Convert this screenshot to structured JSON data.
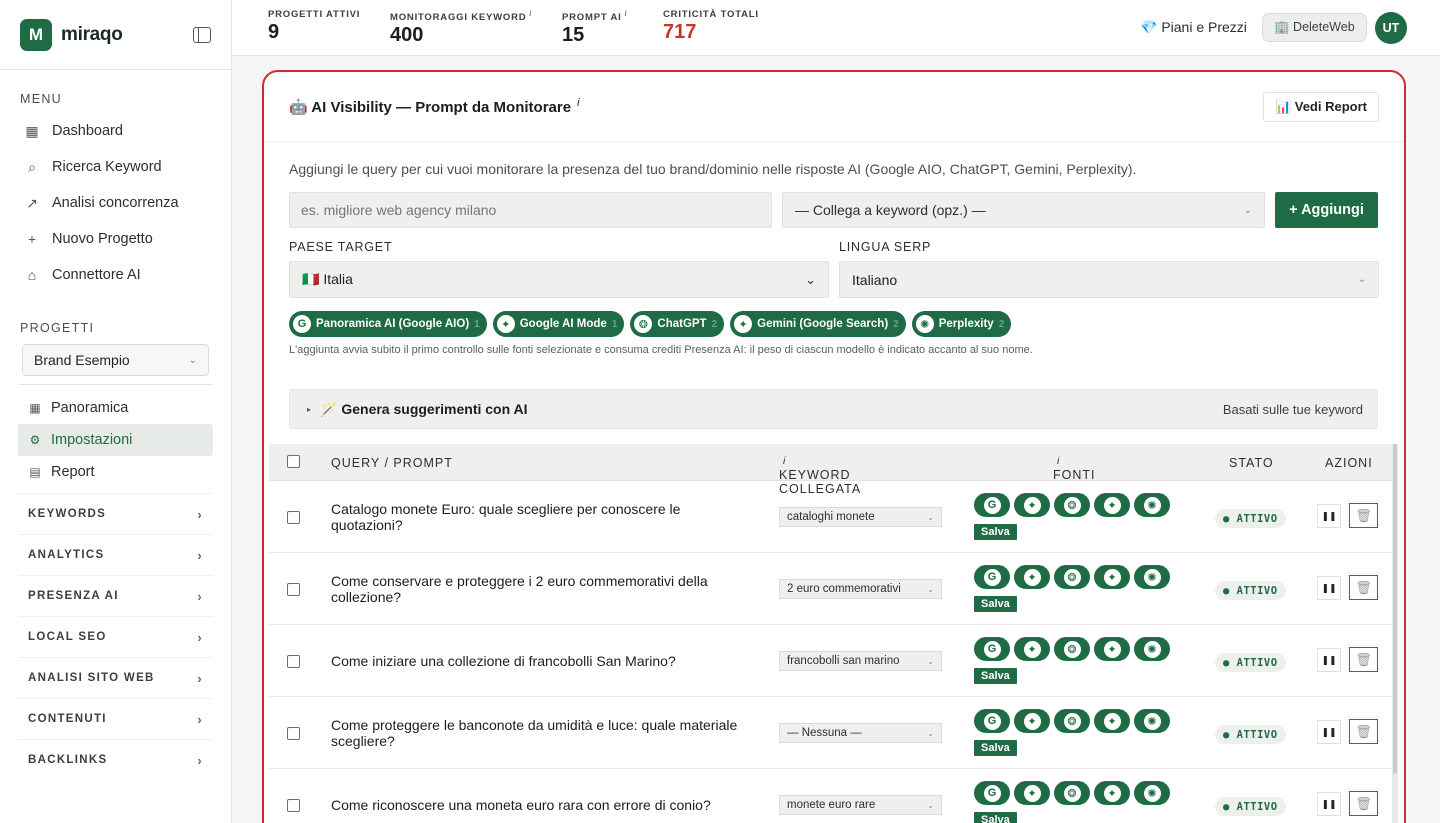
{
  "app": {
    "logo_letter": "M",
    "name": "miraqo"
  },
  "sidebar": {
    "menu_label": "MENU",
    "menu": [
      {
        "label": "Dashboard",
        "icon": "grid-icon"
      },
      {
        "label": "Ricerca Keyword",
        "icon": "search-icon"
      },
      {
        "label": "Analisi concorrenza",
        "icon": "chart-line-icon"
      },
      {
        "label": "Nuovo Progetto",
        "icon": "plus-icon"
      },
      {
        "label": "Connettore AI",
        "icon": "robot-icon"
      }
    ],
    "projects_label": "PROGETTI",
    "project_select": "Brand Esempio",
    "project_nav": [
      {
        "label": "Panoramica",
        "icon": "grid-small-icon"
      },
      {
        "label": "Impostazioni",
        "icon": "gear-icon"
      },
      {
        "label": "Report",
        "icon": "document-icon"
      }
    ],
    "groups": [
      "KEYWORDS",
      "ANALYTICS",
      "PRESENZA AI",
      "LOCAL SEO",
      "ANALISI SITO WEB",
      "CONTENUTI",
      "BACKLINKS"
    ]
  },
  "topbar": {
    "stats": [
      {
        "label": "PROGETTI ATTIVI",
        "value": "9",
        "info": ""
      },
      {
        "label": "MONITORAGGI KEYWORD",
        "value": "400",
        "info": "i"
      },
      {
        "label": "PROMPT AI",
        "value": "15",
        "info": "i"
      },
      {
        "label": "CRITICITÀ TOTALI",
        "value": "717",
        "info": ""
      }
    ],
    "plans_link": "💎 Piani e Prezzi",
    "workspace_button": "🏢 DeleteWeb",
    "avatar": "UT"
  },
  "card": {
    "title": "🤖 AI Visibility — Prompt da Monitorare",
    "title_info": "i",
    "report_button": "📊 Vedi Report",
    "intro": "Aggiungi le query per cui vuoi monitorare la presenza del tuo brand/dominio nelle risposte AI (Google AIO, ChatGPT, Gemini, Perplexity).",
    "query_placeholder": "es. migliore web agency milano",
    "keyword_select": "— Collega a keyword (opz.) —",
    "add_button": "+ Aggiungi",
    "country_label": "PAESE TARGET",
    "country_value": "🇮🇹 Italia",
    "language_label": "LINGUA SERP",
    "language_value": "Italiano",
    "sources": [
      {
        "label": "Panoramica AI (Google AIO)",
        "icon": "google-icon",
        "glyph": "G",
        "weight": "1"
      },
      {
        "label": "Google AI Mode",
        "icon": "sparkle-icon",
        "glyph": "✦",
        "weight": "1"
      },
      {
        "label": "ChatGPT",
        "icon": "openai-icon",
        "glyph": "❂",
        "weight": "2"
      },
      {
        "label": "Gemini (Google Search)",
        "icon": "gemini-icon",
        "glyph": "✦",
        "weight": "2"
      },
      {
        "label": "Perplexity",
        "icon": "perplexity-icon",
        "glyph": "✺",
        "weight": "2"
      }
    ],
    "note": "L'aggiunta avvia subito il primo controllo sulle fonti selezionate e consuma crediti Presenza AI: il peso di ciascun modello è indicato accanto al suo nome.",
    "suggest_title": "🪄 Genera suggerimenti con AI",
    "suggest_right": "Basati sulle tue keyword"
  },
  "table": {
    "headers": {
      "query": "QUERY / PROMPT",
      "keyword": "KEYWORD COLLEGATA",
      "sources": "FONTI",
      "status": "STATO",
      "actions": "AZIONI",
      "info": "i"
    },
    "save_label": "Salva",
    "pause_glyph": "❚❚",
    "delete_glyph": "🗑",
    "rows": [
      {
        "query": "Catalogo monete Euro: quale scegliere per conoscere le quotazioni?",
        "keyword": "cataloghi monete",
        "status": "● ATTIVO"
      },
      {
        "query": "Come conservare e proteggere i 2 euro commemorativi della collezione?",
        "keyword": "2 euro commemorativi",
        "status": "● ATTIVO"
      },
      {
        "query": "Come iniziare una collezione di francobolli San Marino?",
        "keyword": "francobolli san marino",
        "status": "● ATTIVO"
      },
      {
        "query": "Come proteggere le banconote da umidità e luce: quale materiale scegliere?",
        "keyword": "— Nessuna —",
        "status": "● ATTIVO"
      },
      {
        "query": "Come riconoscere una moneta euro rara con errore di conio?",
        "keyword": "monete euro rare",
        "status": "● ATTIVO"
      }
    ]
  }
}
